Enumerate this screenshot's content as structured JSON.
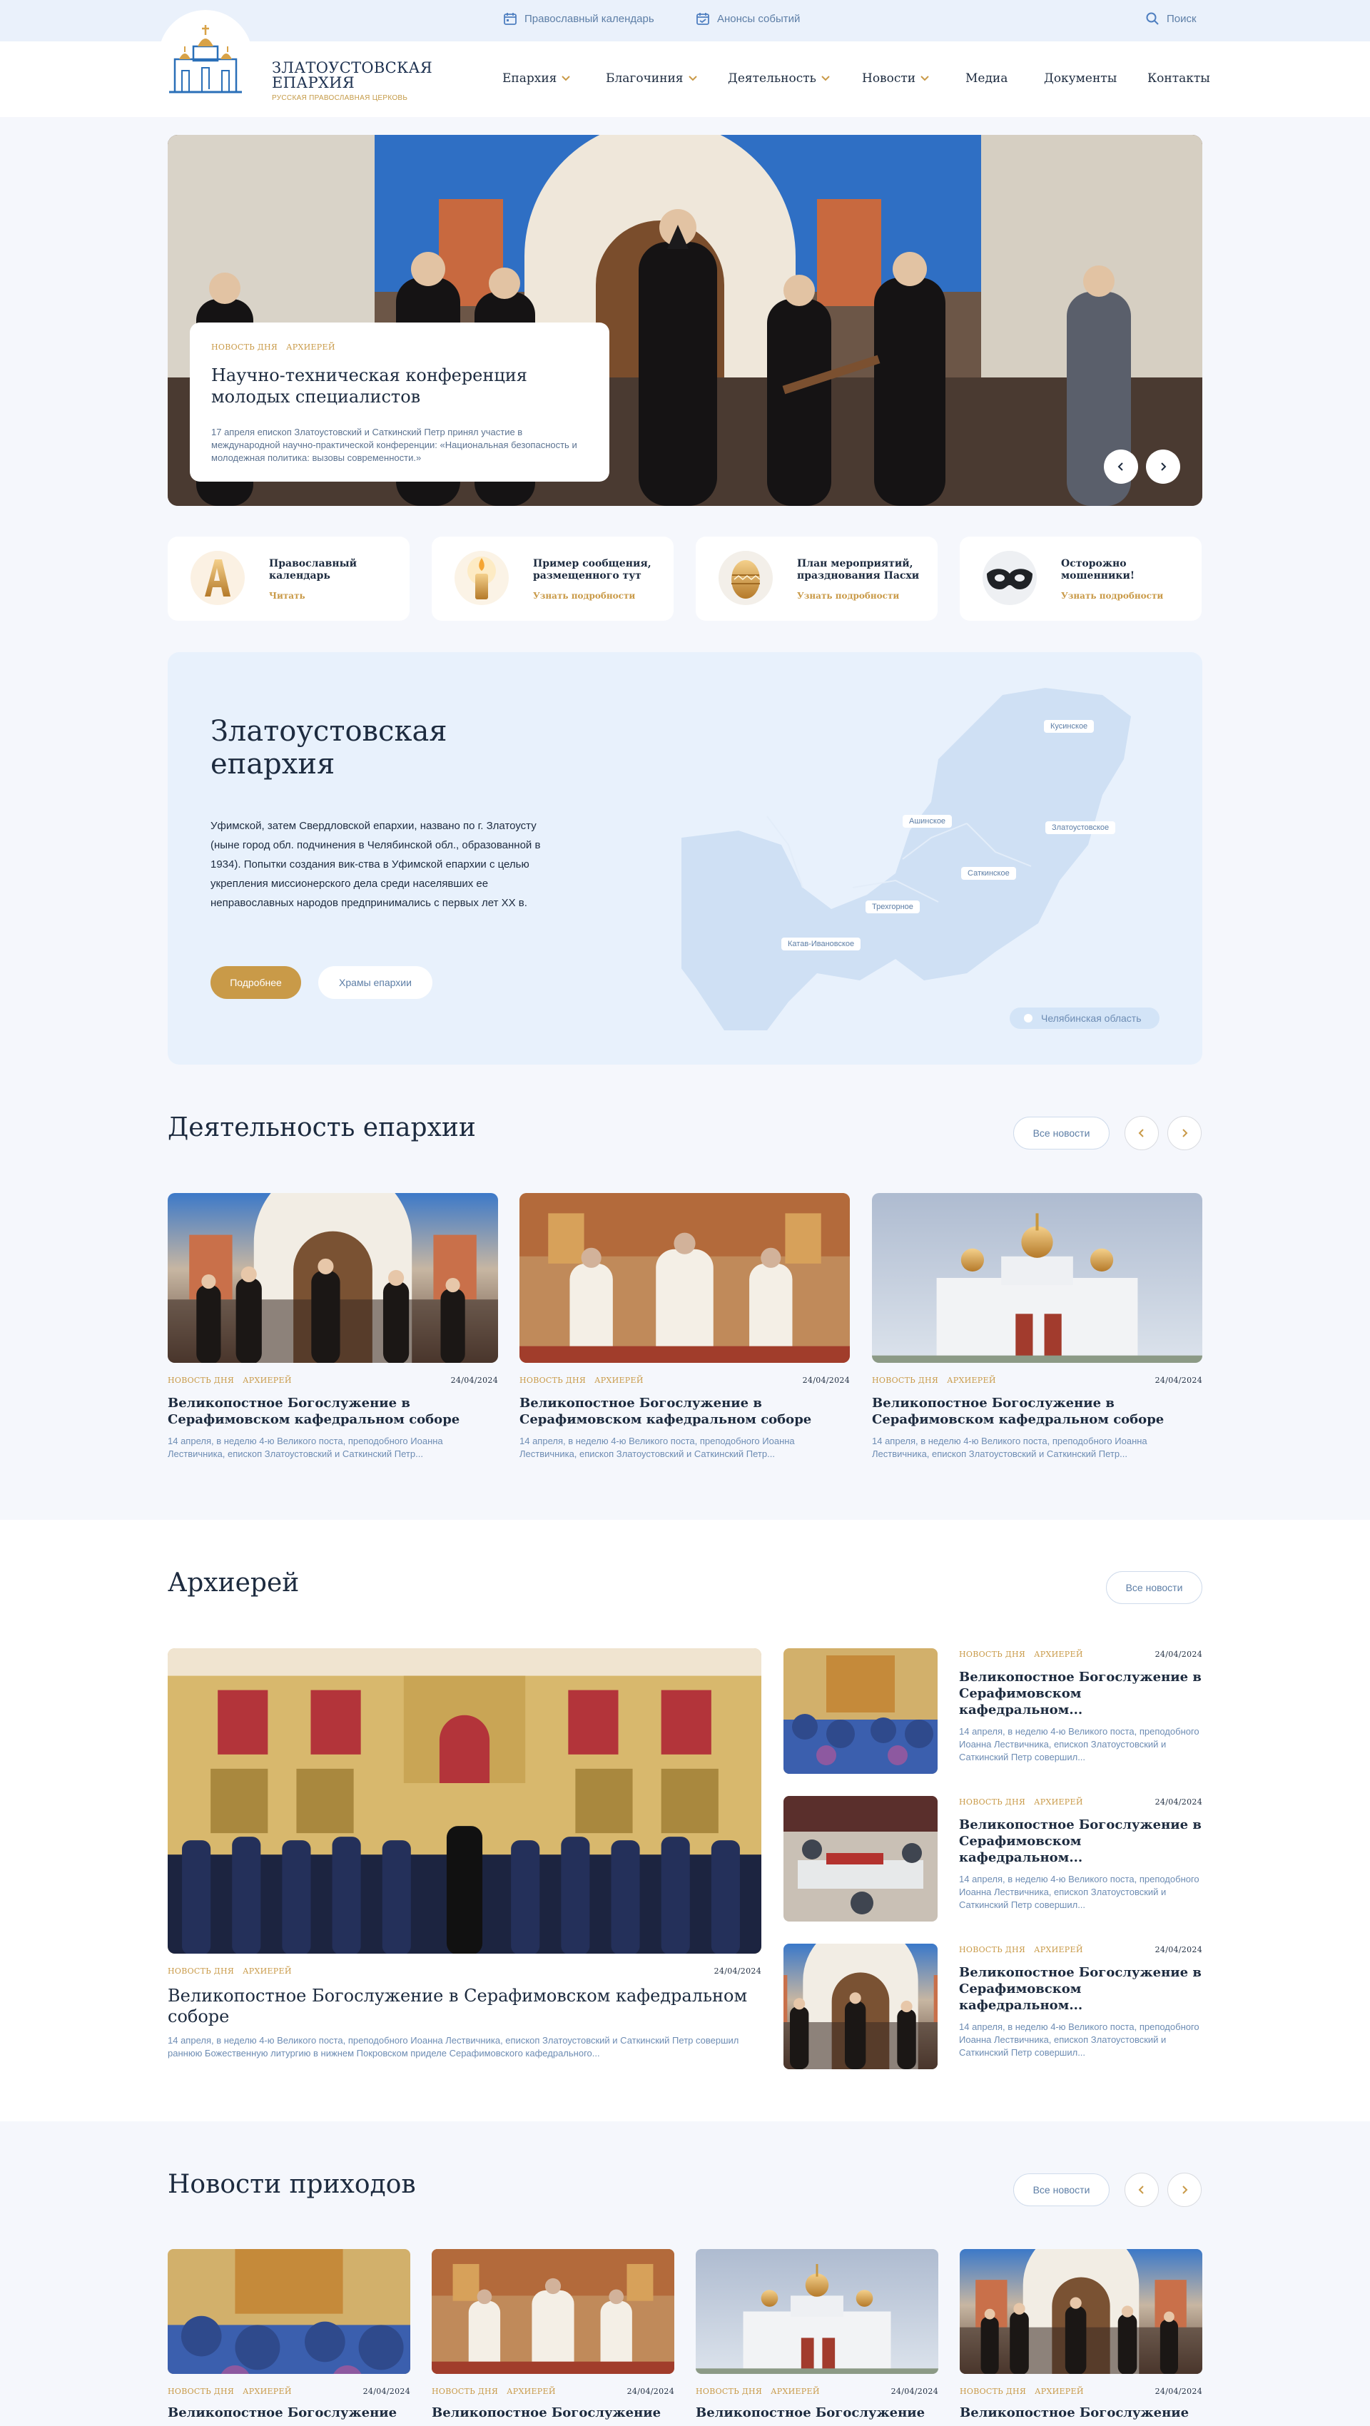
{
  "topbar": {
    "calendar": "Православный календарь",
    "events": "Анонсы событий",
    "search": "Поиск"
  },
  "logo": {
    "title_line1": "ЗЛАТОУСТОВСКАЯ",
    "title_line2": "ЕПАРХИЯ",
    "subtitle": "РУССКАЯ ПРАВОСЛАВНАЯ ЦЕРКОВЬ"
  },
  "nav": [
    {
      "label": "Епархия"
    },
    {
      "label": "Благочиния"
    },
    {
      "label": "Деятельность"
    },
    {
      "label": "Новости"
    },
    {
      "label": "Медиа"
    },
    {
      "label": "Документы"
    },
    {
      "label": "Контакты"
    }
  ],
  "hero": {
    "tag1": "НОВОСТЬ ДНЯ",
    "tag2": "АРХИЕРЕЙ",
    "title": "Научно-техническая конференция молодых специалистов",
    "desc": "17 апреля епископ Златоустовский и Саткинский Петр принял участие в международной научно-практической конференции: «Национальная безопасность и молодежная политика: вызовы современности.»"
  },
  "quick": [
    {
      "title": "Православный календарь",
      "link": "Читать",
      "icon": "calendar-a-icon"
    },
    {
      "title": "Пример сообщения, размещенного тут",
      "link": "Узнать подробности",
      "icon": "candle-icon"
    },
    {
      "title": "План мероприятий, празднования Пасхи",
      "link": "Узнать подробности",
      "icon": "easter-egg-icon"
    },
    {
      "title": "Осторожно мошенники!",
      "link": "Узнать подробности",
      "icon": "mask-icon"
    }
  ],
  "about": {
    "title_line1": "Златоустовская",
    "title_line2": "епархия",
    "text": "Уфимской, затем Свердловской епархии, названо по г. Златоусту (ныне город обл. подчинения в Челябинской обл., образованной в 1934). Попытки создания вик-ства в Уфимской епархии с целью укрепления миссионерского дела среди населявших ее неправославных народов предпринимались с первых лет XX в.",
    "btn_more": "Подробнее",
    "btn_temples": "Храмы епархии",
    "map_labels": {
      "kusinskoe": "Кусинское",
      "ashinskoe": "Ашинское",
      "zlatoustovskoe": "Златоустовское",
      "satkinskoe": "Саткинское",
      "trehgornoe": "Трехгорное",
      "katav": "Катав-Ивановское"
    },
    "legend": "Челябинская область"
  },
  "activity": {
    "title": "Деятельность епархии",
    "all": "Все новости",
    "items": [
      {
        "tag1": "НОВОСТЬ ДНЯ",
        "tag2": "АРХИЕРЕЙ",
        "date": "24/04/2024",
        "title": "Великопостное Богослужение в Серафимовском кафедральном соборе",
        "desc": "14 апреля, в неделю 4-ю Великого поста, преподобного Иоанна Лествичника, епископ Златоустовский и Саткинский Петр..."
      },
      {
        "tag1": "НОВОСТЬ ДНЯ",
        "tag2": "АРХИЕРЕЙ",
        "date": "24/04/2024",
        "title": "Великопостное Богослужение в Серафимовском кафедральном соборе",
        "desc": "14 апреля, в неделю 4-ю Великого поста, преподобного Иоанна Лествичника, епископ Златоустовский и Саткинский Петр..."
      },
      {
        "tag1": "НОВОСТЬ ДНЯ",
        "tag2": "АРХИЕРЕЙ",
        "date": "24/04/2024",
        "title": "Великопостное Богослужение в Серафимовском кафедральном соборе",
        "desc": "14 апреля, в неделю 4-ю Великого поста, преподобного Иоанна Лествичника, епископ Златоустовский и Саткинский Петр..."
      }
    ]
  },
  "bishop": {
    "title": "Архиерей",
    "all": "Все новости",
    "main": {
      "tag1": "НОВОСТЬ ДНЯ",
      "tag2": "АРХИЕРЕЙ",
      "date": "24/04/2024",
      "title": "Великопостное Богослужение в Серафимовском кафедральном соборе",
      "desc": "14 апреля, в неделю 4-ю Великого поста, преподобного Иоанна Лествичника, епископ Златоустовский и Саткинский Петр совершил раннюю Божественную литургию в нижнем Покровском приделе Серафимовского кафедрального..."
    },
    "side": [
      {
        "tag1": "НОВОСТЬ ДНЯ",
        "tag2": "АРХИЕРЕЙ",
        "date": "24/04/2024",
        "title": "Великопостное Богослужение в Серафимовском кафедральном...",
        "desc": "14 апреля, в неделю 4-ю Великого поста, преподобного Иоанна Лествичника, епископ Златоустовский и Саткинский Петр совершил..."
      },
      {
        "tag1": "НОВОСТЬ ДНЯ",
        "tag2": "АРХИЕРЕЙ",
        "date": "24/04/2024",
        "title": "Великопостное Богослужение в Серафимовском кафедральном...",
        "desc": "14 апреля, в неделю 4-ю Великого поста, преподобного Иоанна Лествичника, епископ Златоустовский и Саткинский Петр совершил..."
      },
      {
        "tag1": "НОВОСТЬ ДНЯ",
        "tag2": "АРХИЕРЕЙ",
        "date": "24/04/2024",
        "title": "Великопостное Богослужение в Серафимовском кафедральном...",
        "desc": "14 апреля, в неделю 4-ю Великого поста, преподобного Иоанна Лествичника, епископ Златоустовский и Саткинский Петр совершил..."
      }
    ]
  },
  "parish": {
    "title": "Новости приходов",
    "all": "Все новости",
    "items": [
      {
        "tag1": "НОВОСТЬ ДНЯ",
        "tag2": "АРХИЕРЕЙ",
        "date": "24/04/2024",
        "title": "Великопостное Богослужение"
      },
      {
        "tag1": "НОВОСТЬ ДНЯ",
        "tag2": "АРХИЕРЕЙ",
        "date": "24/04/2024",
        "title": "Великопостное Богослужение"
      },
      {
        "tag1": "НОВОСТЬ ДНЯ",
        "tag2": "АРХИЕРЕЙ",
        "date": "24/04/2024",
        "title": "Великопостное Богослужение"
      },
      {
        "tag1": "НОВОСТЬ ДНЯ",
        "tag2": "АРХИЕРЕЙ",
        "date": "24/04/2024",
        "title": "Великопостное Богослужение"
      }
    ]
  }
}
